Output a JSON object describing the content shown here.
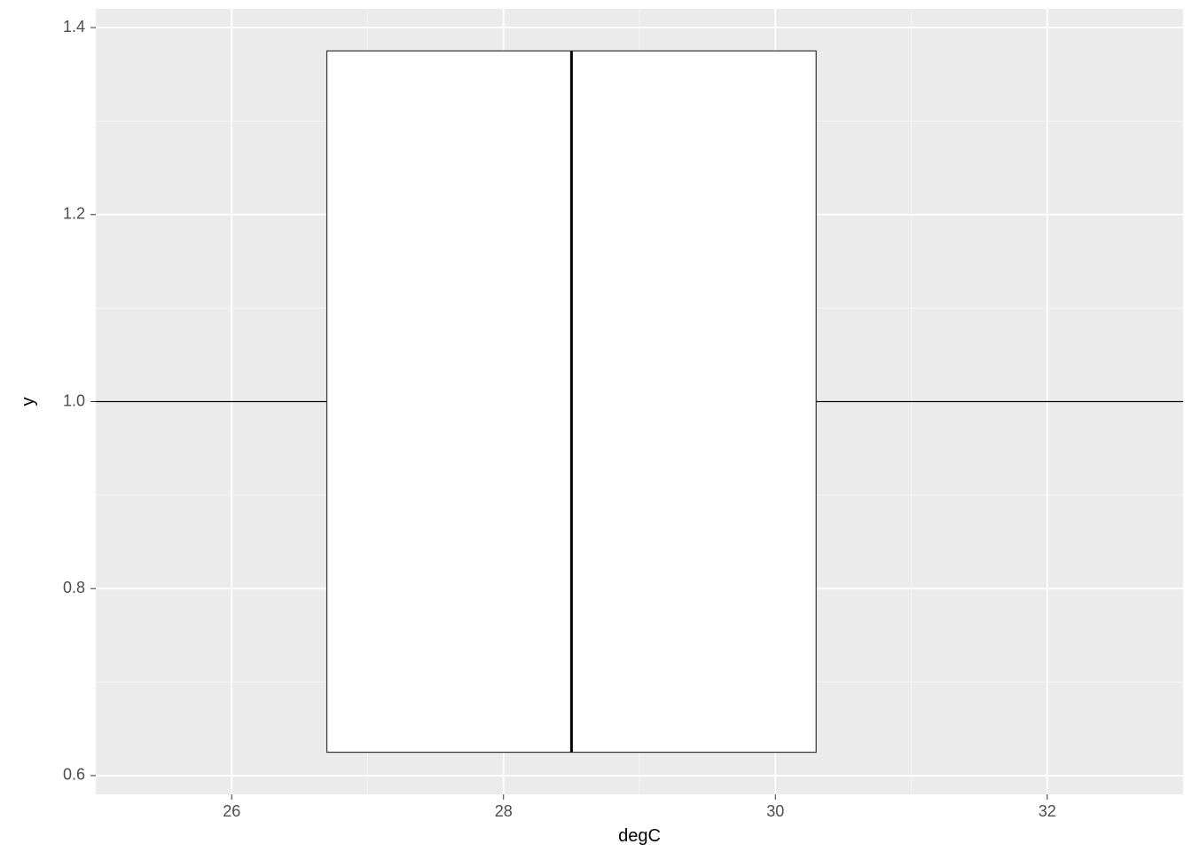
{
  "chart_data": {
    "type": "boxplot",
    "orientation": "horizontal",
    "xlabel": "degC",
    "ylabel": "y",
    "x_ticks": [
      26,
      28,
      30,
      32
    ],
    "y_ticks": [
      0.6,
      0.8,
      1.0,
      1.2,
      1.4
    ],
    "xlim": [
      25.0,
      33.0
    ],
    "ylim": [
      0.58,
      1.42
    ],
    "series": [
      {
        "category": 1.0,
        "min": 25.0,
        "q1": 26.7,
        "median": 28.5,
        "q3": 30.3,
        "max": 33.0,
        "box_half_height": 0.375
      }
    ]
  },
  "labels": {
    "x_axis": "degC",
    "y_axis": "y",
    "x_tick_26": "26",
    "x_tick_28": "28",
    "x_tick_30": "30",
    "x_tick_32": "32",
    "y_tick_06": "0.6",
    "y_tick_08": "0.8",
    "y_tick_10": "1.0",
    "y_tick_12": "1.2",
    "y_tick_14": "1.4"
  }
}
